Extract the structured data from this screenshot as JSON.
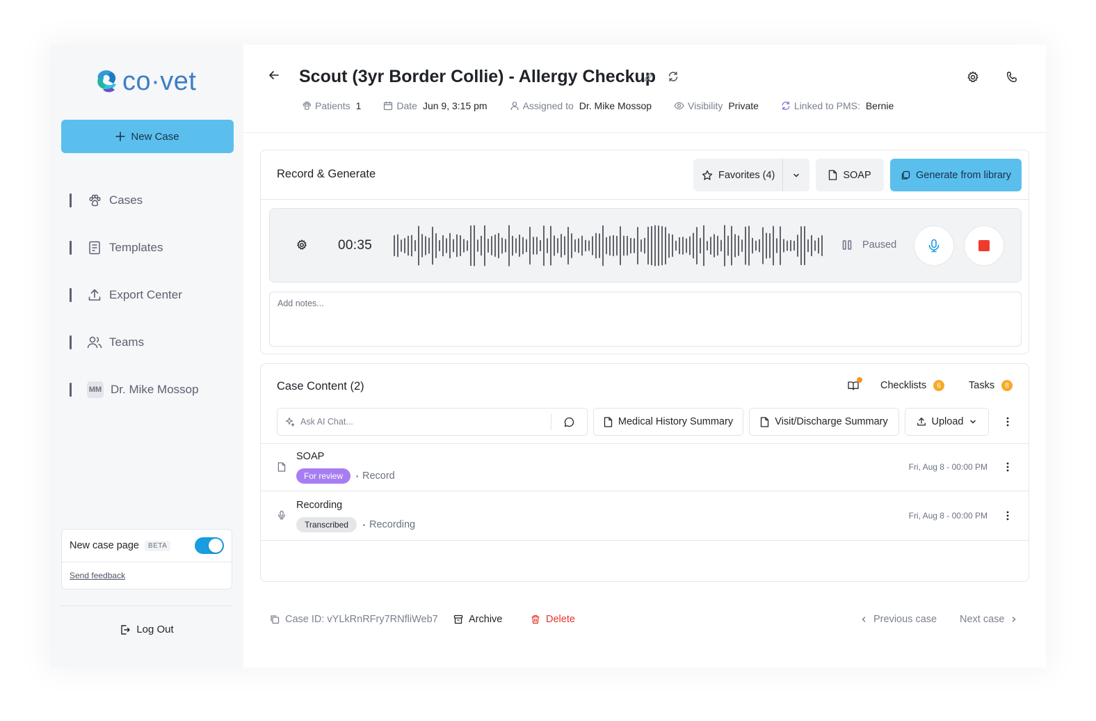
{
  "brand": {
    "name": "co·vet"
  },
  "sidebar": {
    "new_case_label": "New Case",
    "items": [
      {
        "label": "Cases",
        "icon": "paw-icon"
      },
      {
        "label": "Templates",
        "icon": "document-icon"
      },
      {
        "label": "Export Center",
        "icon": "upload-icon"
      },
      {
        "label": "Teams",
        "icon": "users-icon"
      },
      {
        "label": "Dr. Mike Mossop",
        "icon": "avatar",
        "initials": "MM"
      }
    ],
    "beta_card": {
      "label": "New case page",
      "badge": "BETA",
      "toggle_on": true,
      "feedback_label": "Send feedback"
    },
    "logout_label": "Log Out"
  },
  "header": {
    "title": "Scout (3yr Border Collie) - Allergy Checkup",
    "meta": {
      "patients_label": "Patients",
      "patients_value": "1",
      "date_label": "Date",
      "date_value": "Jun 9, 3:15 pm",
      "assigned_label": "Assigned to",
      "assigned_value": "Dr. Mike Mossop",
      "visibility_label": "Visibility",
      "visibility_value": "Private",
      "pms_label": "Linked to PMS:",
      "pms_value": "Bernie"
    }
  },
  "record": {
    "title": "Record & Generate",
    "favorites_label": "Favorites (4)",
    "soap_label": "SOAP",
    "generate_label": "Generate from library",
    "timer": "00:35",
    "status": "Paused",
    "notes_placeholder": "Add notes..."
  },
  "case_content": {
    "title": "Case Content (2)",
    "checklists_label": "Checklists",
    "checklists_count": "6",
    "tasks_label": "Tasks",
    "tasks_count": "8",
    "ai_placeholder": "Ask AI Chat...",
    "medical_history_label": "Medical History Summary",
    "visit_discharge_label": "Visit/Discharge Summary",
    "upload_label": "Upload",
    "rows": [
      {
        "title": "SOAP",
        "tag": "For review",
        "sub": "Record",
        "date": "Fri, Aug 8 - 00:00 PM"
      },
      {
        "title": "Recording",
        "tag": "Transcribed",
        "sub": "Recording",
        "date": "Fri, Aug 8 - 00:00 PM"
      }
    ]
  },
  "footer": {
    "case_id": "Case ID: vYLkRnRFry7RNfliWeb7",
    "archive_label": "Archive",
    "delete_label": "Delete",
    "previous_label": "Previous case",
    "next_label": "Next case"
  },
  "colors": {
    "accent": "#5bbfee",
    "toggle": "#1a9de0",
    "review_tag": "#a77ef2",
    "badge": "#f7a928",
    "delete": "#e5352b",
    "stop": "#ef3b2d"
  }
}
